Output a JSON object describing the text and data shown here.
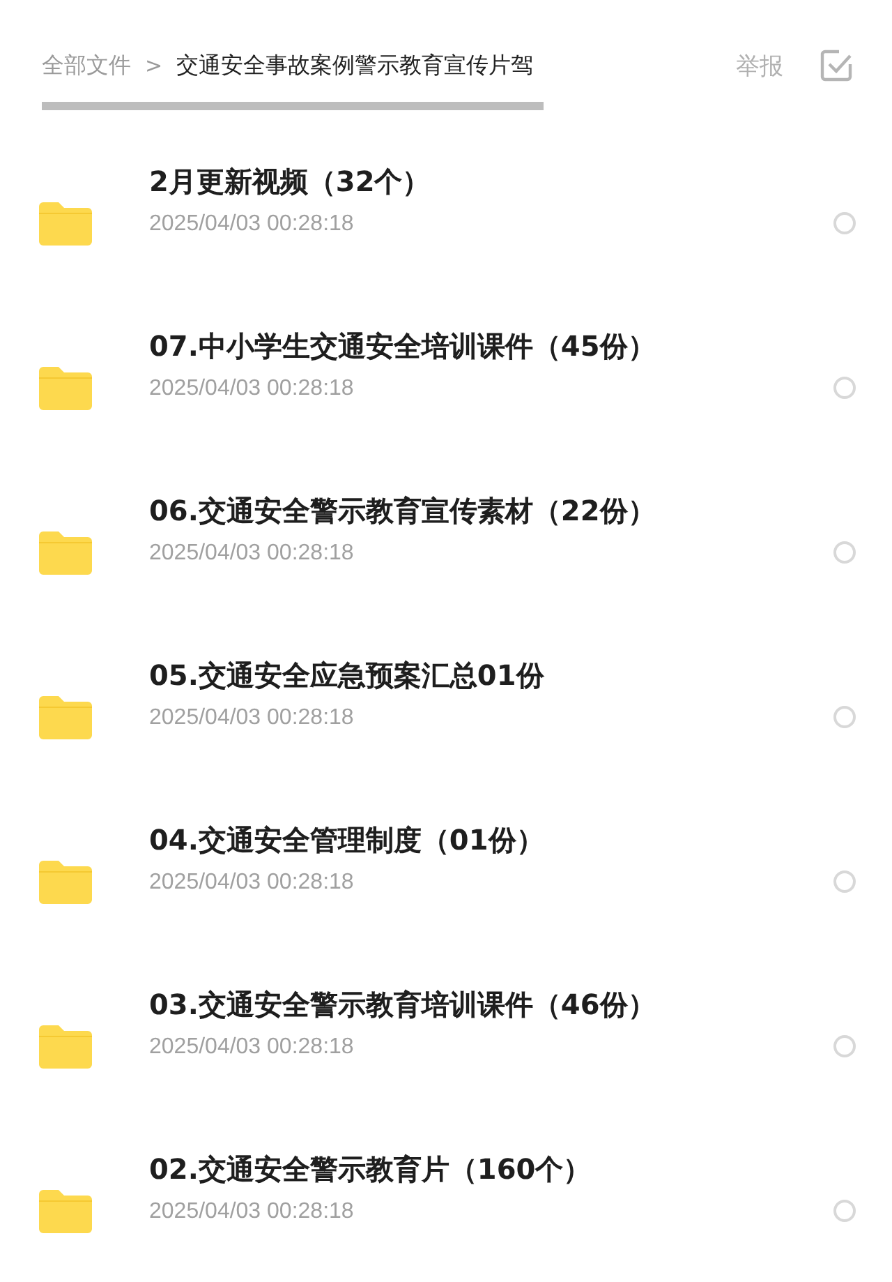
{
  "breadcrumb": {
    "root": "全部文件",
    "separator": ">",
    "current": "交通安全事故案例警示教育宣传片驾"
  },
  "report": "举报",
  "files": [
    {
      "name": "2月更新视频（32个）",
      "date": "2025/04/03 00:28:18",
      "selected": false
    },
    {
      "name": "07.中小学生交通安全培训课件（45份）",
      "date": "2025/04/03 00:28:18",
      "selected": false
    },
    {
      "name": "06.交通安全警示教育宣传素材（22份）",
      "date": "2025/04/03 00:28:18",
      "selected": false
    },
    {
      "name": "05.交通安全应急预案汇总01份",
      "date": "2025/04/03 00:28:18",
      "selected": false
    },
    {
      "name": "04.交通安全管理制度（01份）",
      "date": "2025/04/03 00:28:18",
      "selected": false
    },
    {
      "name": "03.交通安全警示教育培训课件（46份）",
      "date": "2025/04/03 00:28:18",
      "selected": false
    },
    {
      "name": "02.交通安全警示教育片（160个）",
      "date": "2025/04/03 00:28:18",
      "selected": false
    }
  ]
}
